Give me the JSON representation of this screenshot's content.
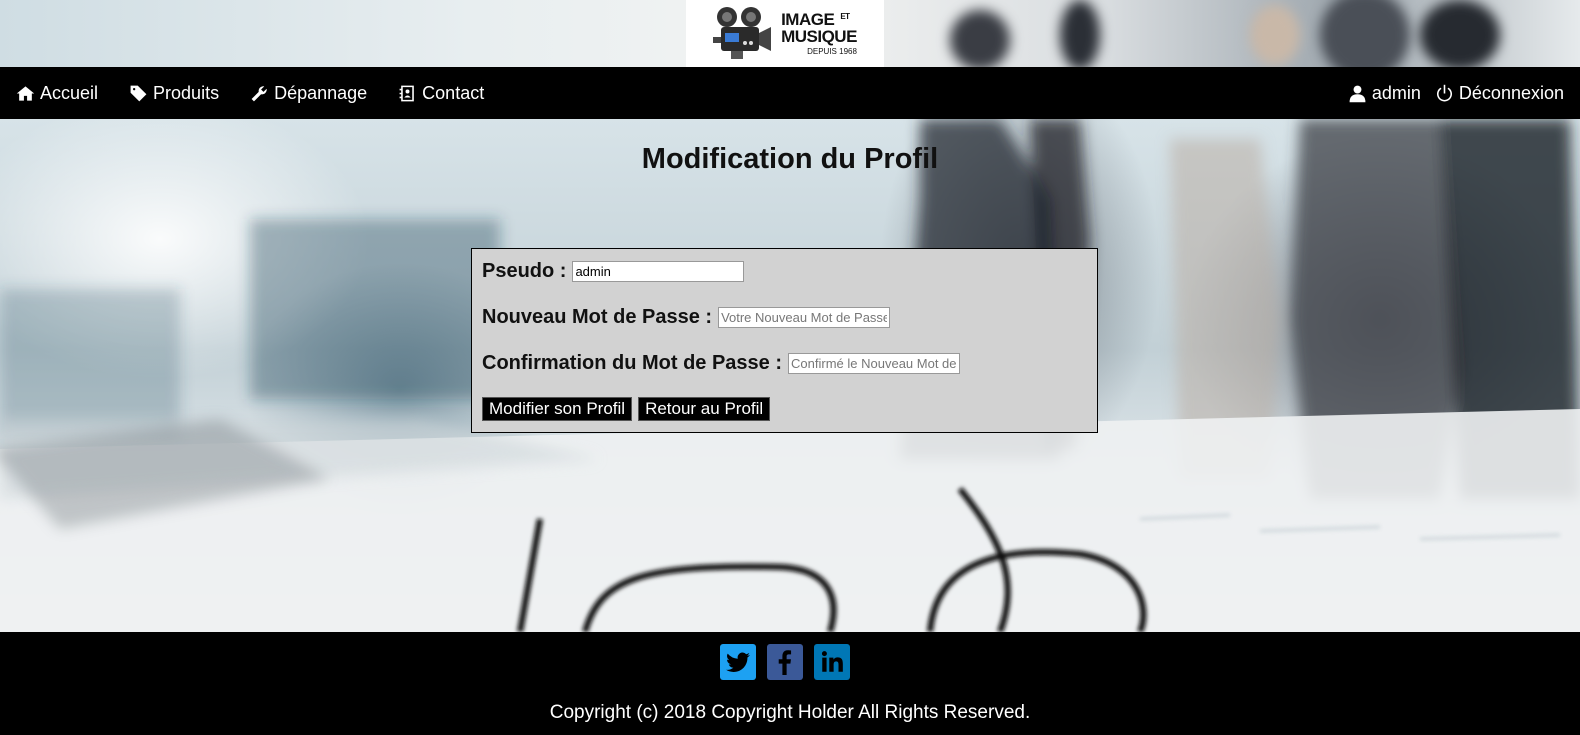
{
  "logo": {
    "line1": "IMAGE",
    "et": "ET",
    "line2": "MUSIQUE",
    "tagline": "DEPUIS 1968"
  },
  "nav": {
    "left": [
      {
        "label": "Accueil",
        "icon": "home-icon"
      },
      {
        "label": "Produits",
        "icon": "tag-icon"
      },
      {
        "label": "Dépannage",
        "icon": "wrench-icon"
      },
      {
        "label": "Contact",
        "icon": "contact-card-icon"
      }
    ],
    "right": [
      {
        "label": "admin",
        "icon": "user-icon"
      },
      {
        "label": "Déconnexion",
        "icon": "power-icon"
      }
    ]
  },
  "page": {
    "title": "Modification du Profil"
  },
  "form": {
    "pseudo_label": "Pseudo :",
    "pseudo_value": "admin",
    "password_label": "Nouveau Mot de Passe :",
    "password_placeholder": "Votre Nouveau Mot de Passe",
    "confirm_label": "Confirmation du Mot de Passe :",
    "confirm_placeholder": "Confirmé le Nouveau Mot de Passe",
    "submit_label": "Modifier son Profil",
    "back_label": "Retour au Profil"
  },
  "footer": {
    "social": [
      {
        "name": "twitter",
        "color": "#1da1f2"
      },
      {
        "name": "facebook",
        "color": "#3b5998"
      },
      {
        "name": "linkedin",
        "color": "#0077b5"
      }
    ],
    "copyright": "Copyright (c) 2018 Copyright Holder All Rights Reserved."
  },
  "colors": {
    "nav_bg": "#000000",
    "form_bg": "#d2d2d2",
    "button_bg": "#000000"
  }
}
